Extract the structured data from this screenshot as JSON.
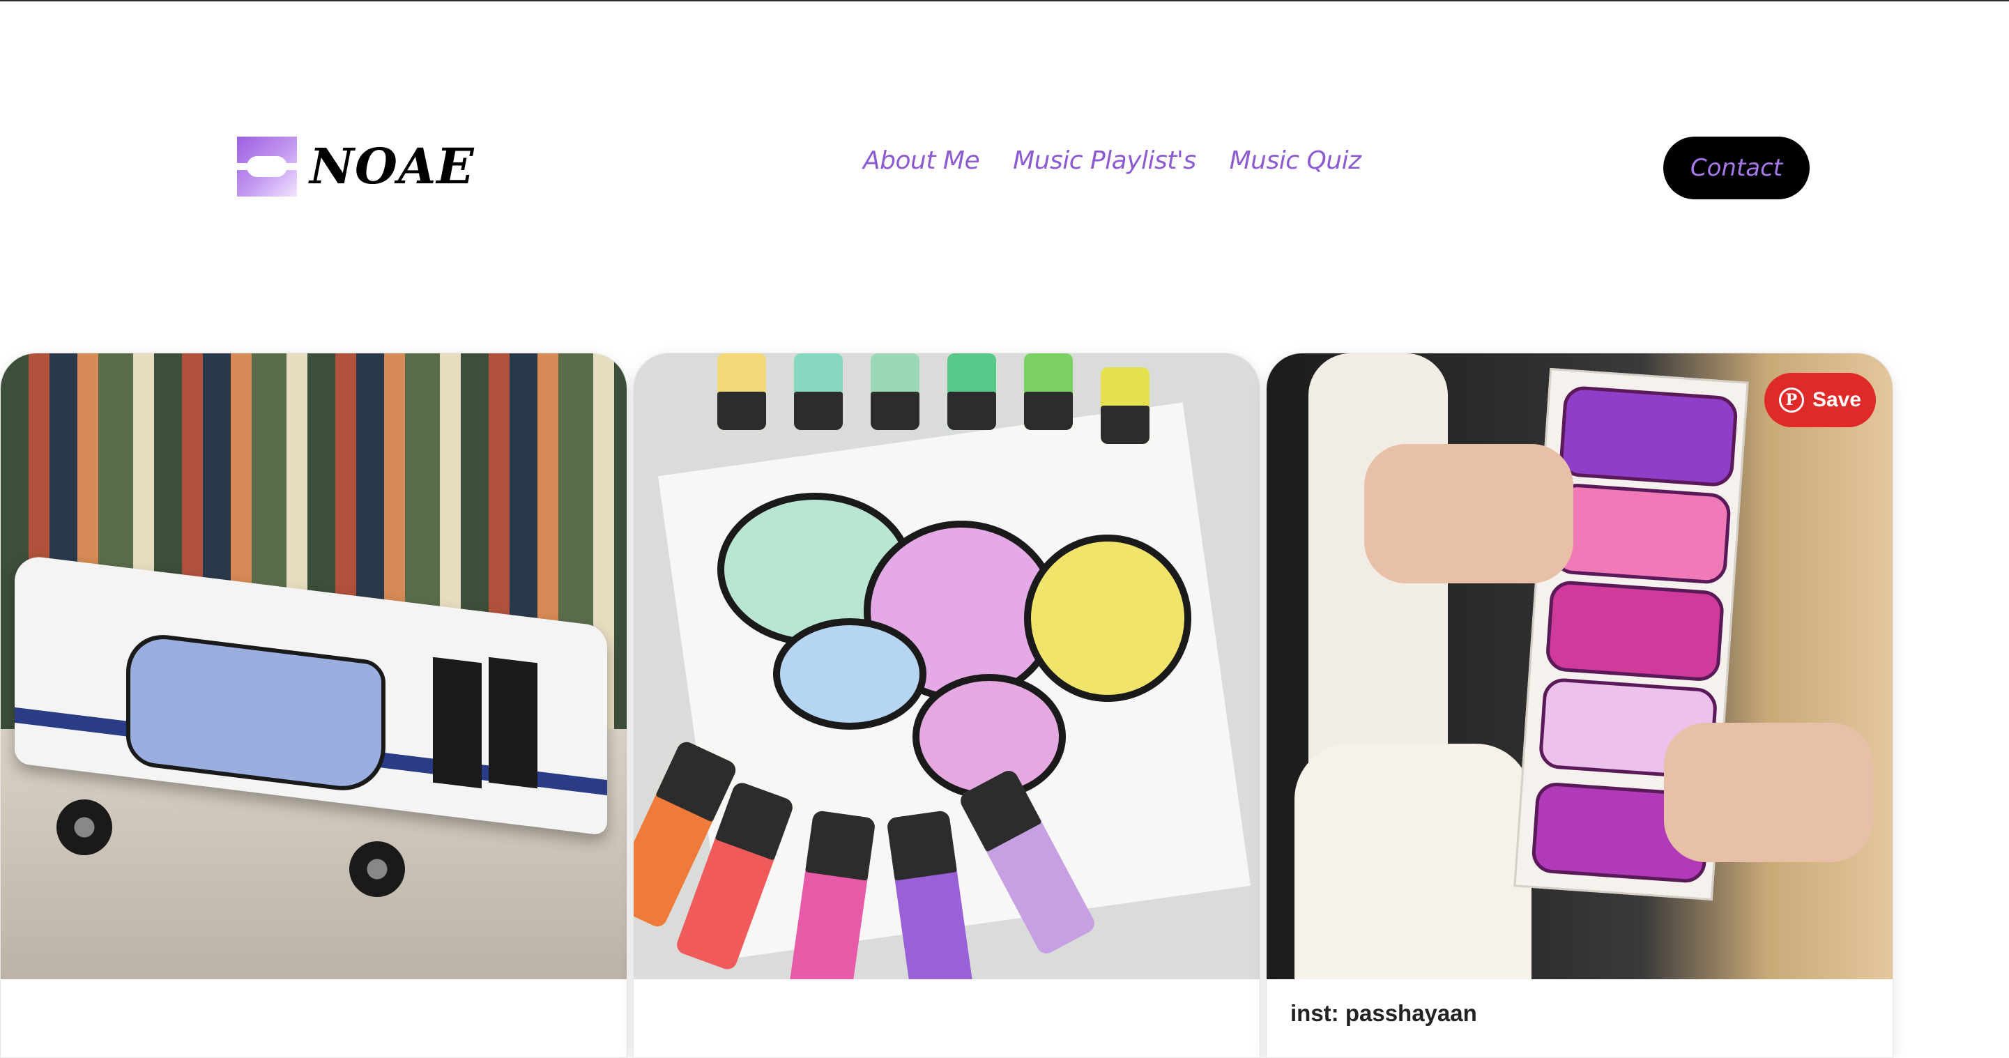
{
  "brand": {
    "name": "NOAE",
    "colors": {
      "accent": "#8c5bd1",
      "button_bg": "#000000",
      "save_red": "#e02a2a"
    }
  },
  "nav": {
    "items": [
      {
        "label": "About Me"
      },
      {
        "label": "Music Playlist's"
      },
      {
        "label": "Music Quiz"
      }
    ]
  },
  "header": {
    "contact_label": "Contact"
  },
  "cards": [
    {
      "image": "graffiti-bus-model",
      "caption": ""
    },
    {
      "image": "graffiti-markers-drawing",
      "caption": ""
    },
    {
      "image": "graffiti-sticker-strip",
      "caption": "inst: passhayaan",
      "save_label": "Save",
      "save_icon": "pinterest-icon"
    }
  ]
}
